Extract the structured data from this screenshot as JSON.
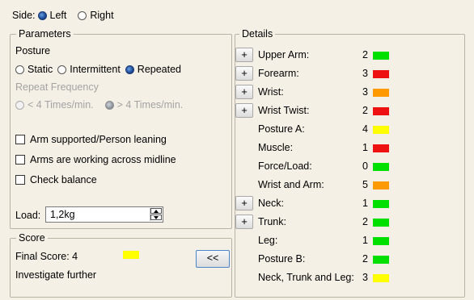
{
  "side": {
    "label": "Side:",
    "options": [
      "Left",
      "Right"
    ],
    "selected": "Left"
  },
  "parameters": {
    "title": "Parameters",
    "posture_label": "Posture",
    "posture_options": [
      "Static",
      "Intermittent",
      "Repeated"
    ],
    "posture_selected": "Repeated",
    "repeat_label": "Repeat Frequency",
    "repeat_options": [
      "< 4 Times/min.",
      "> 4 Times/min."
    ],
    "repeat_selected": "> 4 Times/min.",
    "checkboxes": [
      "Arm supported/Person leaning",
      "Arms are working across midline",
      "Check balance"
    ],
    "load_label": "Load:",
    "load_value": "1,2kg"
  },
  "score": {
    "title": "Score",
    "final_label": "Final Score: 4",
    "final_color": "#ffff00",
    "message": "Investigate further",
    "back_button": "<<"
  },
  "details": {
    "title": "Details",
    "items": [
      {
        "label": "Upper Arm:",
        "value": "2",
        "color": "#00e000",
        "expand": true
      },
      {
        "label": "Forearm:",
        "value": "3",
        "color": "#ee1111",
        "expand": true
      },
      {
        "label": "Wrist:",
        "value": "3",
        "color": "#ff9900",
        "expand": true
      },
      {
        "label": "Wrist Twist:",
        "value": "2",
        "color": "#ee1111",
        "expand": true
      },
      {
        "label": "Posture A:",
        "value": "4",
        "color": "#ffff00",
        "expand": false
      },
      {
        "label": "Muscle:",
        "value": "1",
        "color": "#ee1111",
        "expand": false
      },
      {
        "label": "Force/Load:",
        "value": "0",
        "color": "#00e000",
        "expand": false
      },
      {
        "label": "Wrist and Arm:",
        "value": "5",
        "color": "#ff9900",
        "expand": false
      },
      {
        "label": "Neck:",
        "value": "1",
        "color": "#00e000",
        "expand": true
      },
      {
        "label": "Trunk:",
        "value": "2",
        "color": "#00e000",
        "expand": true
      },
      {
        "label": "Leg:",
        "value": "1",
        "color": "#00e000",
        "expand": false
      },
      {
        "label": "Posture B:",
        "value": "2",
        "color": "#00e000",
        "expand": false
      },
      {
        "label": "Neck, Trunk and Leg:",
        "value": "3",
        "color": "#ffff00",
        "expand": false
      }
    ],
    "expand_label": "+"
  }
}
